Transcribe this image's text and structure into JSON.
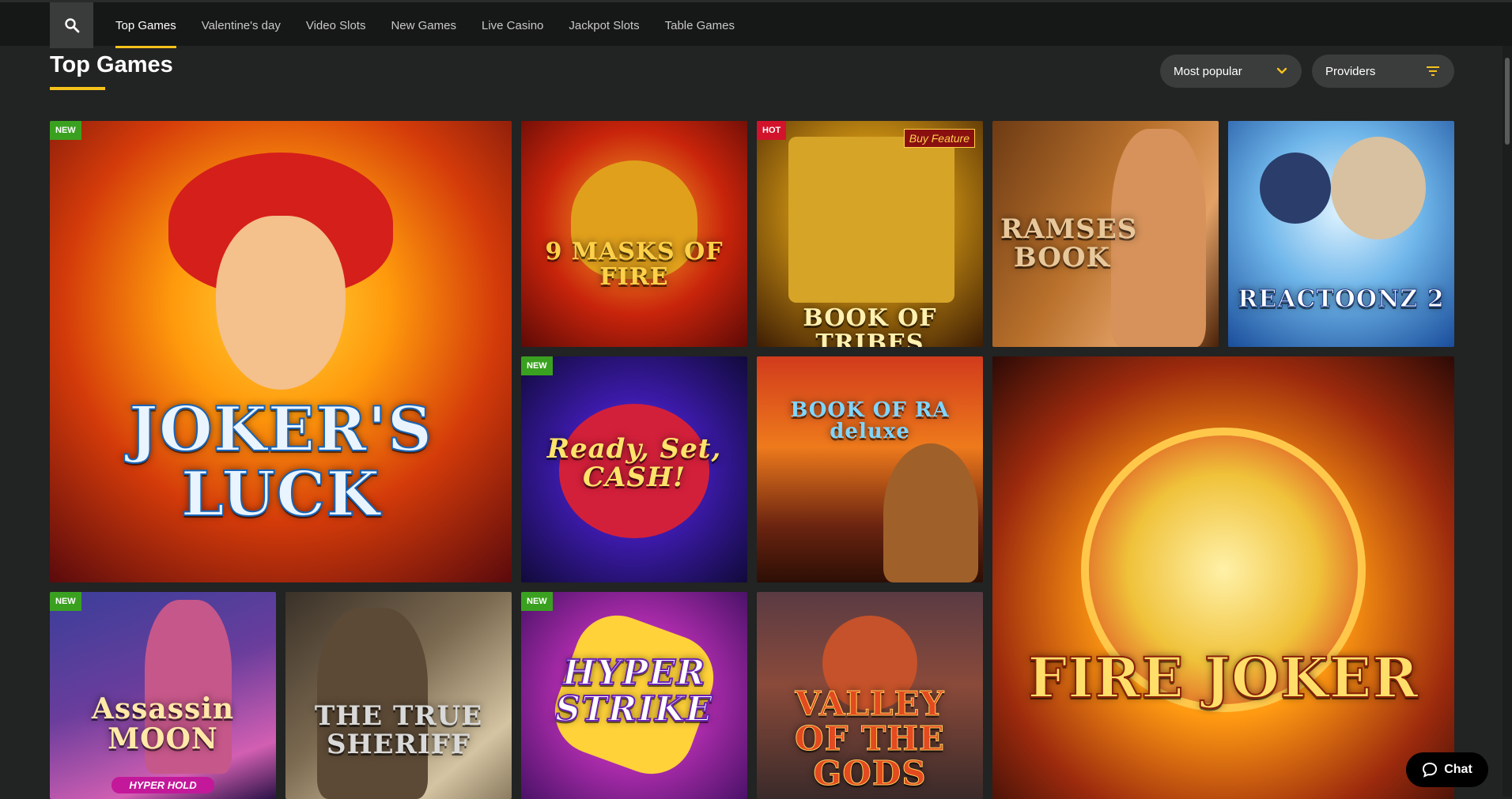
{
  "nav": {
    "search_icon": "search-icon",
    "tabs": [
      {
        "label": "Top Games",
        "active": true
      },
      {
        "label": "Valentine's day",
        "active": false
      },
      {
        "label": "Video Slots",
        "active": false
      },
      {
        "label": "New Games",
        "active": false
      },
      {
        "label": "Live Casino",
        "active": false
      },
      {
        "label": "Jackpot Slots",
        "active": false
      },
      {
        "label": "Table Games",
        "active": false
      }
    ]
  },
  "page": {
    "title": "Top Games",
    "accent": "#f5c21b"
  },
  "filters": {
    "sort_label": "Most popular",
    "providers_label": "Providers"
  },
  "games": [
    {
      "title": "JOKER'S LUCK",
      "badge": "NEW"
    },
    {
      "title": "9 MASKS OF FIRE",
      "badge": ""
    },
    {
      "title": "BOOK OF TRIBES",
      "badge": "HOT",
      "extra": "Buy Feature"
    },
    {
      "title": "RAMSES BOOK",
      "badge": ""
    },
    {
      "title": "REACTOONZ 2",
      "badge": ""
    },
    {
      "title": "Ready, Set, CASH!",
      "badge": "NEW"
    },
    {
      "title": "BOOK OF RA deluxe",
      "badge": ""
    },
    {
      "title": "FIRE JOKER",
      "badge": ""
    },
    {
      "title": "Assassin MOON",
      "badge": "NEW",
      "extra": "HYPER HOLD"
    },
    {
      "title": "THE TRUE SHERIFF",
      "badge": ""
    },
    {
      "title": "HYPER STRIKE",
      "badge": "NEW"
    },
    {
      "title": "VALLEY OF THE GODS",
      "badge": ""
    }
  ],
  "chat": {
    "label": "Chat"
  },
  "colors": {
    "badge_new": "#3aa120",
    "badge_hot": "#d2132b",
    "background": "#222323"
  }
}
